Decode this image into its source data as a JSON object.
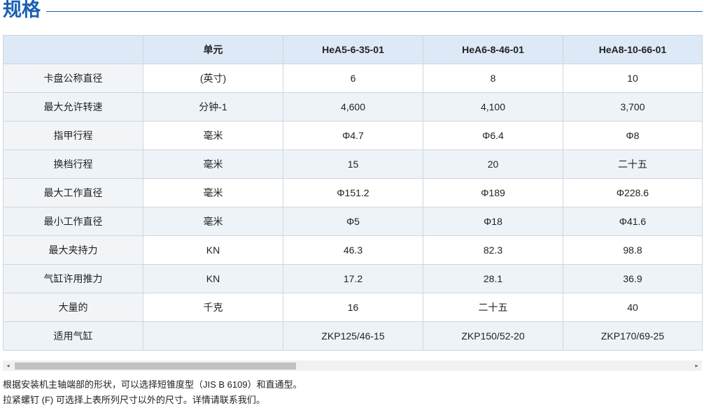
{
  "heading": {
    "title": "规格"
  },
  "table": {
    "headers": [
      "",
      "单元",
      "HeA5-6-35-01",
      "HeA6-8-46-01",
      "HeA8-10-66-01"
    ],
    "rows": [
      [
        "卡盘公称直径",
        "(英寸)",
        "6",
        "8",
        "10"
      ],
      [
        "最大允许转速",
        "分钟-1",
        "4,600",
        "4,100",
        "3,700"
      ],
      [
        "指甲行程",
        "毫米",
        "Φ4.7",
        "Φ6.4",
        "Φ8"
      ],
      [
        "换档行程",
        "毫米",
        "15",
        "20",
        "二十五"
      ],
      [
        "最大工作直径",
        "毫米",
        "Φ151.2",
        "Φ189",
        "Φ228.6"
      ],
      [
        "最小工作直径",
        "毫米",
        "Φ5",
        "Φ18",
        "Φ41.6"
      ],
      [
        "最大夹持力",
        "KN",
        "46.3",
        "82.3",
        "98.8"
      ],
      [
        "气缸许用推力",
        "KN",
        "17.2",
        "28.1",
        "36.9"
      ],
      [
        "大量的",
        "千克",
        "16",
        "二十五",
        "40"
      ],
      [
        "适用气缸",
        "",
        "ZKP125/46-15",
        "ZKP150/52-20",
        "ZKP170/69-25"
      ]
    ]
  },
  "scrollbar": {
    "left_arrow_icon": "◂",
    "right_arrow_icon": "▸"
  },
  "notes": [
    "根据安装机主轴端部的形状，可以选择短锥度型（JIS B 6109）和直通型。",
    "拉紧螺钉 (F) 可选择上表所列尺寸以外的尺寸。详情请联系我们。"
  ]
}
